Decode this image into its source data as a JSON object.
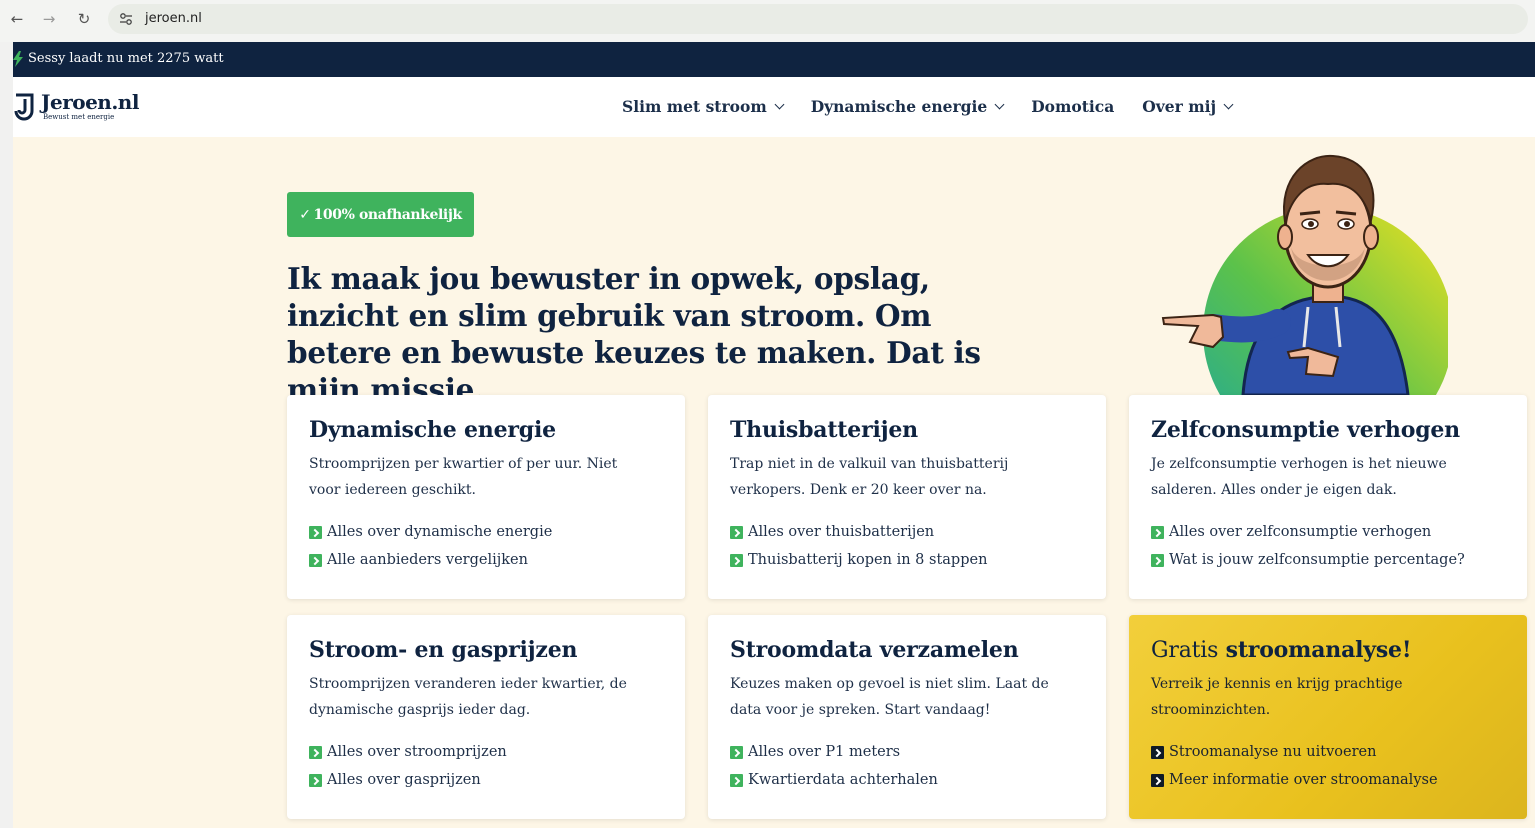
{
  "browser": {
    "url": "jeroen.nl",
    "icons": [
      "back-icon",
      "forward-icon",
      "reload-icon",
      "site-settings-icon"
    ]
  },
  "topbar": {
    "status": "Sessy laadt nu met 2275 watt",
    "icon": "lightning-bolt-icon"
  },
  "header": {
    "logo_name": "Jeroen.nl",
    "logo_tagline": "Bewust met energie",
    "menu": [
      {
        "label": "Slim met stroom",
        "dropdown": true
      },
      {
        "label": "Dynamische energie",
        "dropdown": true
      },
      {
        "label": "Domotica",
        "dropdown": false
      },
      {
        "label": "Over mij",
        "dropdown": true
      }
    ]
  },
  "hero": {
    "badge": "100% onafhankelijk",
    "title": "Ik maak jou bewuster in opwek, opslag, inzicht en slim gebruik van stroom. Om betere en bewuste keuzes te maken. Dat is mijn missie."
  },
  "colors": {
    "navy": "#0f2340",
    "green": "#3fb35d",
    "cream": "#fdf6e6",
    "yellow": "#f2cf3b"
  },
  "cards": [
    {
      "title": "Dynamische energie",
      "desc": "Stroomprijzen per kwartier of per uur. Niet voor iedereen geschikt.",
      "links": [
        "Alles over dynamische energie",
        "Alle aanbieders vergelijken"
      ]
    },
    {
      "title": "Thuisbatterijen",
      "desc": "Trap niet in de valkuil van thuisbatterij verkopers. Denk er 20 keer over na.",
      "links": [
        "Alles over thuisbatterijen",
        "Thuisbatterij kopen in 8 stappen"
      ]
    },
    {
      "title": "Zelfconsumptie verhogen",
      "desc": "Je zelfconsumptie verhogen is het nieuwe salderen. Alles onder je eigen dak.",
      "links": [
        "Alles over zelfconsumptie verhogen",
        "Wat is jouw zelfconsumptie percentage?"
      ]
    },
    {
      "title": "Stroom- en gasprijzen",
      "desc": "Stroomprijzen veranderen ieder kwartier, de dynamische gasprijs ieder dag.",
      "links": [
        "Alles over stroomprijzen",
        "Alles over gasprijzen"
      ]
    },
    {
      "title": "Stroomdata verzamelen",
      "desc": "Keuzes maken op gevoel is niet slim. Laat de data voor je spreken. Start vandaag!",
      "links": [
        "Alles over P1 meters",
        "Kwartierdata achterhalen"
      ]
    },
    {
      "title_prefix": "Gratis",
      "title": "stroomanalyse!",
      "desc": "Verreik je kennis en krijg prachtige stroominzichten.",
      "links": [
        "Stroomanalyse nu uitvoeren",
        "Meer informatie over stroomanalyse"
      ]
    }
  ]
}
